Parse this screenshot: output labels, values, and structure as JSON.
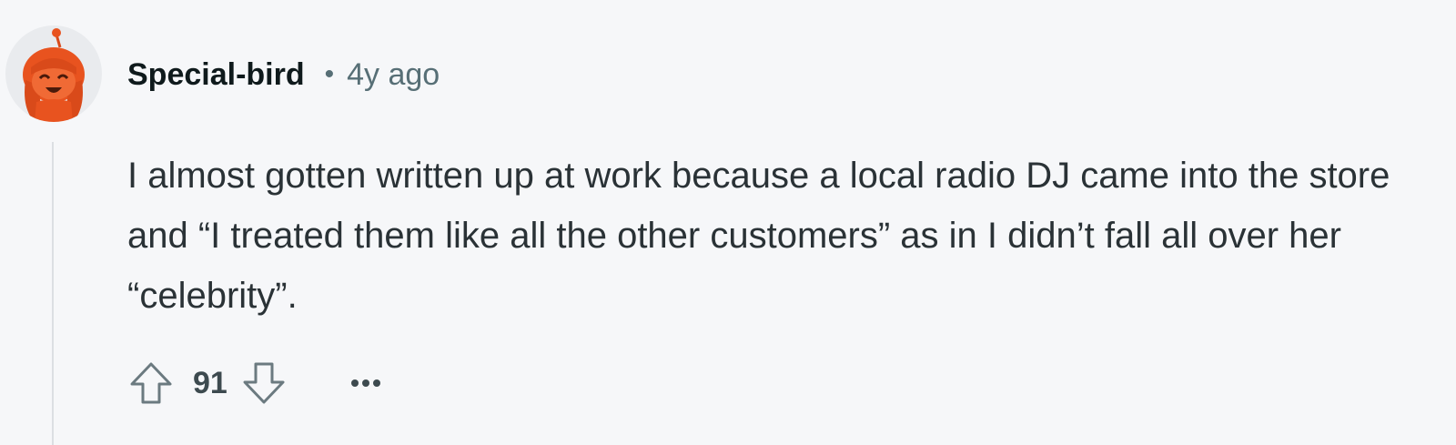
{
  "comment": {
    "author": "Special-bird",
    "separator": "•",
    "timestamp": "4y ago",
    "body": "I almost gotten written up at work because a local radio DJ came into the store and “I treated them like all the other customers” as in I didn’t fall all over her “celebrity”.",
    "score": "91",
    "avatar_icon": "snoo-avatar-icon",
    "upvote_icon": "upvote-arrow-icon",
    "downvote_icon": "downvote-arrow-icon",
    "more_icon": "more-options-icon"
  },
  "colors": {
    "background": "#f6f7f9",
    "avatar_orange": "#e8531f",
    "text_primary": "#0f1a1c",
    "text_secondary": "#576f76"
  }
}
